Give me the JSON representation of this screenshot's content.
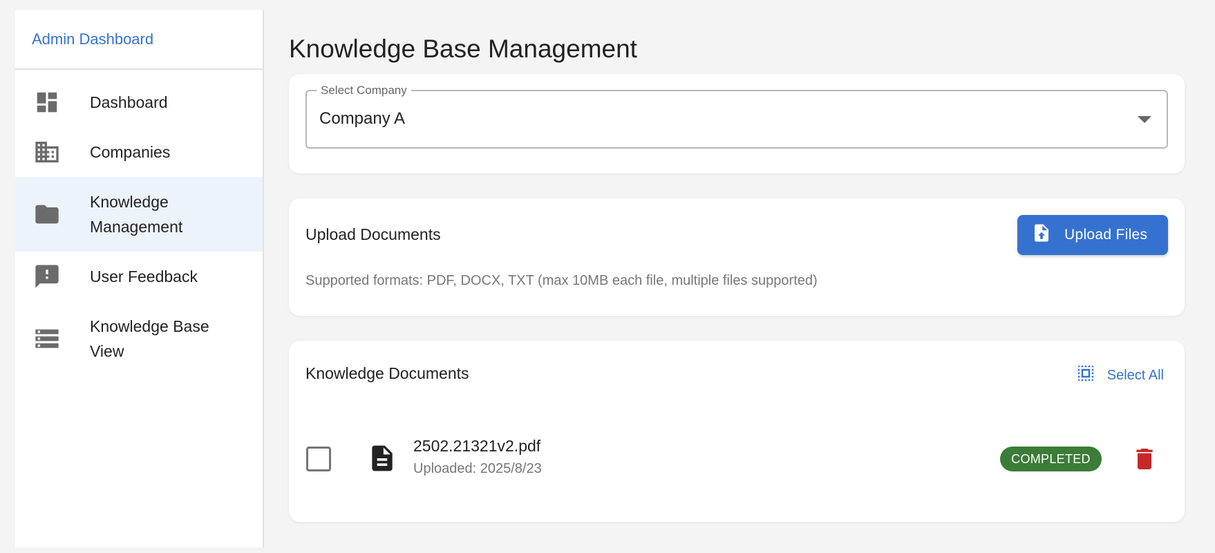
{
  "sidebar": {
    "brand": "Admin Dashboard",
    "items": [
      {
        "label": "Dashboard",
        "icon": "dashboard-icon"
      },
      {
        "label": "Companies",
        "icon": "building-icon"
      },
      {
        "label": "Knowledge Management",
        "icon": "folder-icon",
        "active": true
      },
      {
        "label": "User Feedback",
        "icon": "feedback-icon"
      },
      {
        "label": "Knowledge Base View",
        "icon": "storage-icon"
      }
    ]
  },
  "page": {
    "title": "Knowledge Base Management"
  },
  "company_select": {
    "label": "Select Company",
    "value": "Company A"
  },
  "upload": {
    "title": "Upload Documents",
    "button_label": "Upload Files",
    "hint": "Supported formats: PDF, DOCX, TXT (max 10MB each file, multiple files supported)"
  },
  "documents": {
    "title": "Knowledge Documents",
    "select_all_label": "Select All",
    "items": [
      {
        "name": "2502.21321v2.pdf",
        "uploaded": "Uploaded: 2025/8/23",
        "status": "COMPLETED"
      }
    ]
  },
  "colors": {
    "accent": "#3572d0",
    "status_completed": "#3b7c37",
    "delete": "#c62828",
    "active_nav_bg": "#edf3fb"
  }
}
